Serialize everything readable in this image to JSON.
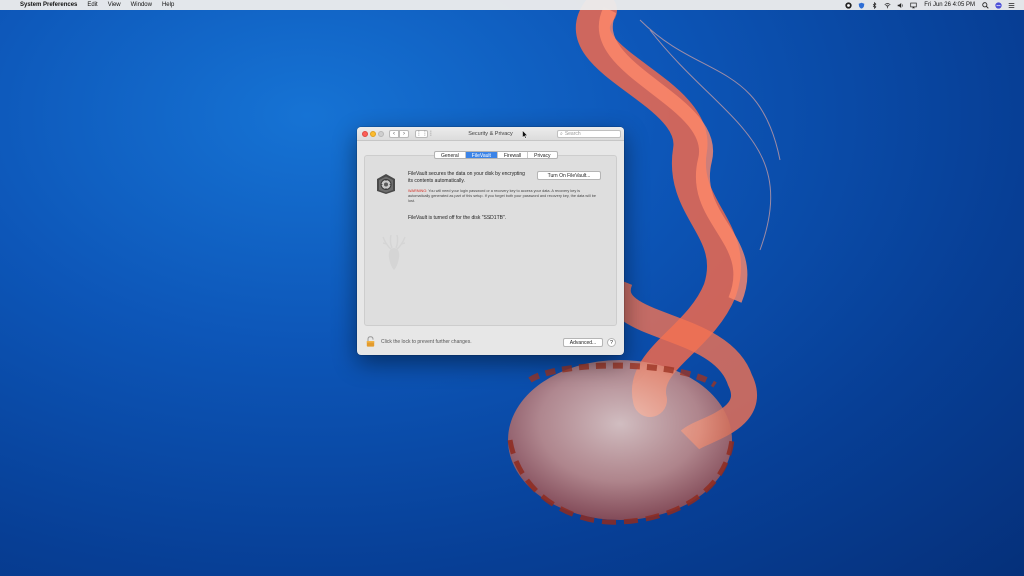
{
  "menubar": {
    "apple": "",
    "app_name": "System Preferences",
    "menus": [
      "Edit",
      "View",
      "Window",
      "Help"
    ],
    "clock": "Fri Jun 26  4:05 PM"
  },
  "window": {
    "title": "Security & Privacy",
    "search": {
      "placeholder": "Search",
      "value": ""
    },
    "nav": {
      "back": "‹",
      "forward": "›",
      "grid": "⋮⋮⋮"
    },
    "tabs": [
      {
        "label": "General",
        "active": false
      },
      {
        "label": "FileVault",
        "active": true
      },
      {
        "label": "Firewall",
        "active": false
      },
      {
        "label": "Privacy",
        "active": false
      }
    ],
    "filevault": {
      "description": "FileVault secures the data on your disk by encrypting its contents automatically.",
      "turn_on_label": "Turn On FileVault...",
      "warning_label": "WARNING:",
      "warning_text": "You will need your login password or a recovery key to access your data. A recovery key is automatically generated as part of this setup. If you forget both your password and recovery key, the data will be lost.",
      "status": "FileVault is turned off for the disk \"SSD1TB\"."
    },
    "footer": {
      "lock_text": "Click the lock to prevent further changes.",
      "advanced_label": "Advanced...",
      "help_label": "?"
    }
  },
  "colors": {
    "accent": "#3b84e8",
    "warning": "#d62c21",
    "close": "#fc5f57",
    "minimize": "#fdbc2e"
  }
}
